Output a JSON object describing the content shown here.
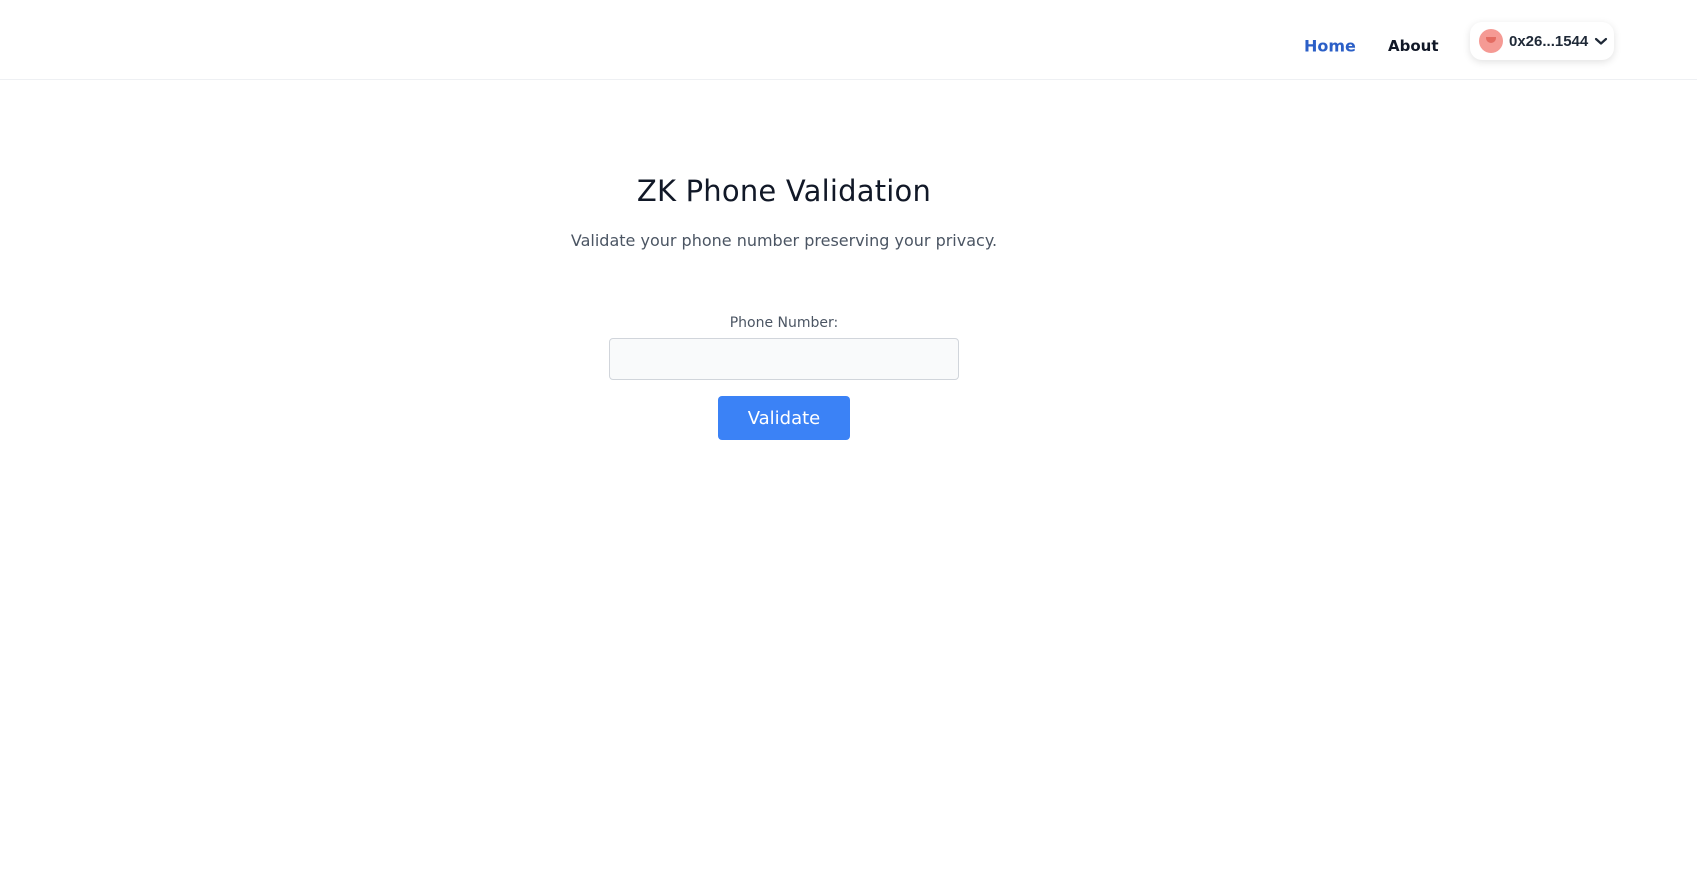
{
  "nav": {
    "home_label": "Home",
    "about_label": "About",
    "wallet": {
      "address": "0x26...1544"
    }
  },
  "main": {
    "title": "ZK Phone Validation",
    "subtitle": "Validate your phone number preserving your privacy.",
    "form": {
      "phone_label": "Phone Number:",
      "phone_value": "",
      "phone_placeholder": "",
      "submit_label": "Validate"
    }
  },
  "colors": {
    "accent": "#3b82f6",
    "active_nav": "#2b5fc7",
    "avatar": "#f59a94"
  },
  "icons": {
    "wallet_avatar": "avatar-icon",
    "wallet_dropdown": "chevron-down-icon"
  }
}
